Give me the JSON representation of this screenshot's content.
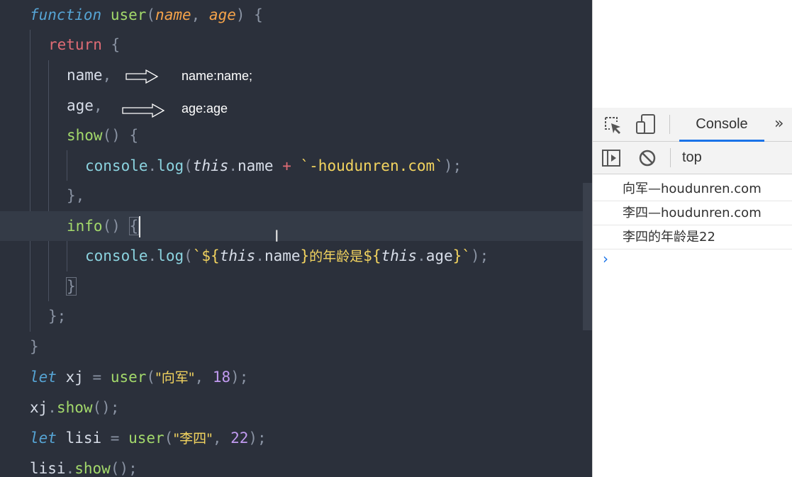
{
  "editor": {
    "annotations": [
      "name:name;",
      "age:age"
    ],
    "code": {
      "l1": {
        "a": "function",
        "b": "user",
        "c": "(",
        "d": "name",
        "e": ", ",
        "f": "age",
        "g": ") {"
      },
      "l2": {
        "a": "return",
        "b": " {"
      },
      "l3": {
        "a": "name",
        "b": ","
      },
      "l4": {
        "a": "age",
        "b": ","
      },
      "l5": {
        "a": "show",
        "b": "() {"
      },
      "l6": {
        "a": "console",
        "b": ".",
        "c": "log",
        "d": "(",
        "e": "this",
        "f": ".",
        "g": "name",
        "h": " + ",
        "i": "`-houdunren.com`",
        "j": ");"
      },
      "l7": {
        "a": "},"
      },
      "l8": {
        "a": "info",
        "b": "() ",
        "c": "{"
      },
      "l9": {
        "a": "console",
        "b": ".",
        "c": "log",
        "d": "(",
        "e": "`${",
        "f": "this",
        "g": ".",
        "h": "name",
        "i": "}",
        "j": "的年龄是",
        "k": "${",
        "l": "this",
        "m": ".",
        "n": "age",
        "o": "}`",
        "p": ");"
      },
      "l10": {
        "a": "}"
      },
      "l11": {
        "a": "};"
      },
      "l12": {
        "a": "}"
      },
      "l13": {
        "a": "let",
        "b": " xj ",
        "c": "= ",
        "d": "user",
        "e": "(",
        "f": "\"向军\"",
        "g": ", ",
        "h": "18",
        "i": ");"
      },
      "l14": {
        "a": "xj",
        "b": ".",
        "c": "show",
        "d": "();"
      },
      "l15": {
        "a": "let",
        "b": " lisi ",
        "c": "= ",
        "d": "user",
        "e": "(",
        "f": "\"李四\"",
        "g": ", ",
        "h": "22",
        "i": ");"
      },
      "l16": {
        "a": "lisi",
        "b": ".",
        "c": "show",
        "d": "();"
      }
    }
  },
  "devtools": {
    "tabs": {
      "console": "Console"
    },
    "context": "top",
    "messages": [
      "向军—houdunren.com",
      "李四—houdunren.com",
      "李四的年龄是22"
    ],
    "prompt": "›",
    "icons": [
      "inspect-element-icon",
      "device-toolbar-icon",
      "more-tabs-icon",
      "sidebar-toggle-icon",
      "clear-console-icon"
    ],
    "accent": "#1a73e8"
  }
}
